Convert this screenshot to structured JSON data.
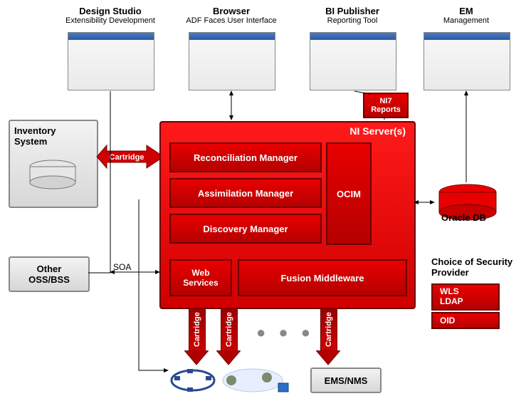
{
  "top": {
    "designStudio": {
      "title": "Design Studio",
      "sub": "Extensibility Development"
    },
    "browser": {
      "title": "Browser",
      "sub": "ADF Faces User Interface"
    },
    "biPublisher": {
      "title": "BI Publisher",
      "sub": "Reporting Tool"
    },
    "em": {
      "title": "EM",
      "sub": "Management"
    }
  },
  "ni7Reports": "NI7\nReports",
  "inventorySystem": "Inventory\nSystem",
  "otherOssBss": "Other\nOSS/BSS",
  "soaLabel": "SOA",
  "cartridge": "Cartridge",
  "server": {
    "title": "NI Server(s)",
    "reconciliation": "Reconciliation Manager",
    "assimilation": "Assimilation Manager",
    "discovery": "Discovery Manager",
    "ocim": "OCIM",
    "webServices": "Web\nServices",
    "fusion": "Fusion Middleware"
  },
  "oracleDb": "Oracle DB",
  "security": {
    "title": "Choice of Security\nProvider",
    "wls": "WLS\nLDAP",
    "oid": "OID"
  },
  "emsNms": "EMS/NMS",
  "dots": "● ● ●"
}
